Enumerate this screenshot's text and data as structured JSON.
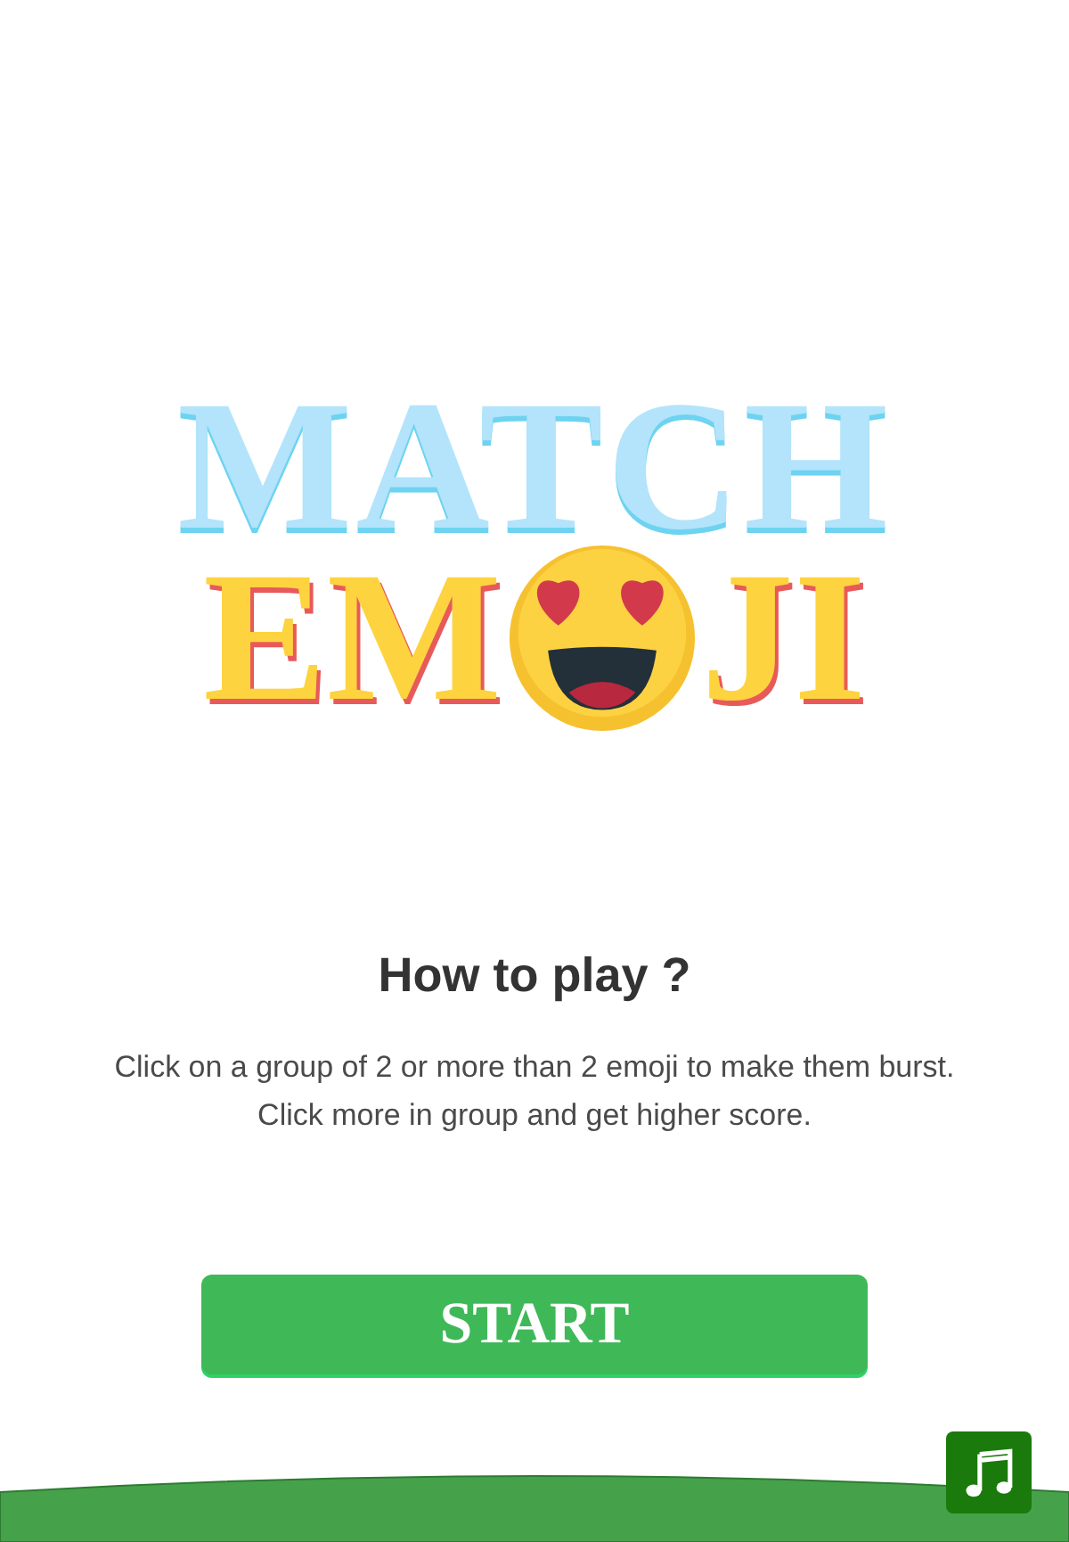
{
  "logo": {
    "top_word": "MATCH",
    "bottom_start": "EM",
    "bottom_end": "JI"
  },
  "heading": "How to play ?",
  "instructions": "Click on a group of 2 or more than 2 emoji to make them burst. Click more in group and get higher score.",
  "start_button": "START"
}
